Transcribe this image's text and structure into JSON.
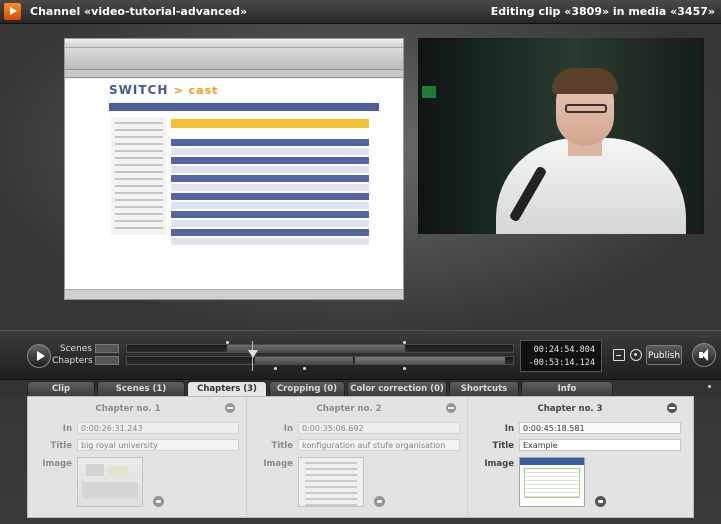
{
  "window": {
    "title_left": "Channel «video-tutorial-advanced»",
    "title_right": "Editing clip «3809» in media «3457»"
  },
  "player": {
    "screen_logo_main": "SWITCH",
    "screen_logo_sub": "> cast"
  },
  "controls": {
    "scenes_label": "Scenes",
    "chapters_label": "Chapters",
    "timecode_in": "00:24:54.804",
    "timecode_duration": "-00:53:14.124",
    "publish_label": "Publish"
  },
  "tabs": [
    {
      "label": "Clip"
    },
    {
      "label": "Scenes (1)"
    },
    {
      "label": "Chapters (3)"
    },
    {
      "label": "Cropping (0)"
    },
    {
      "label": "Color correction (0)"
    },
    {
      "label": "Shortcuts"
    },
    {
      "label": "Info"
    }
  ],
  "chapters": [
    {
      "heading": "Chapter no. 1",
      "in_label": "In",
      "in_value": "0:00:26:31.243",
      "title_label": "Title",
      "title_value": "big royal university",
      "image_label": "Image"
    },
    {
      "heading": "Chapter no. 2",
      "in_label": "In",
      "in_value": "0:00:35:06.692",
      "title_label": "Title",
      "title_value": "konfiguration auf stufe organisation",
      "image_label": "Image"
    },
    {
      "heading": "Chapter no. 3",
      "in_label": "In",
      "in_value": "0:00:45:18.581",
      "title_label": "Title",
      "title_value": "Example",
      "image_label": "Image"
    }
  ]
}
